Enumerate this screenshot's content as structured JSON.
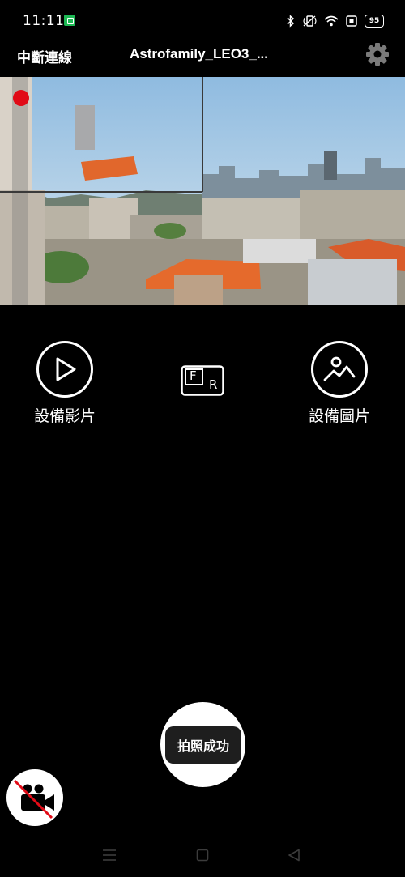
{
  "status_bar": {
    "time": "11:11",
    "battery_level": "95",
    "icons": [
      "bluetooth-icon",
      "vibrate-icon",
      "wifi-icon",
      "screen-record-icon",
      "battery-icon"
    ]
  },
  "header": {
    "disconnect_label": "中斷連線",
    "device_name": "Astrofamily_LEO3_..."
  },
  "camera": {
    "recording_indicator_color": "#e10b17"
  },
  "actions": {
    "device_video_label": "設備影片",
    "fr_button_letters": [
      "F",
      "R"
    ],
    "device_photo_label": "設備圖片"
  },
  "shutter": {
    "toast_text": "拍照成功"
  },
  "colors": {
    "background": "#000000",
    "accent_red": "#e10b17",
    "foreground": "#ffffff"
  }
}
